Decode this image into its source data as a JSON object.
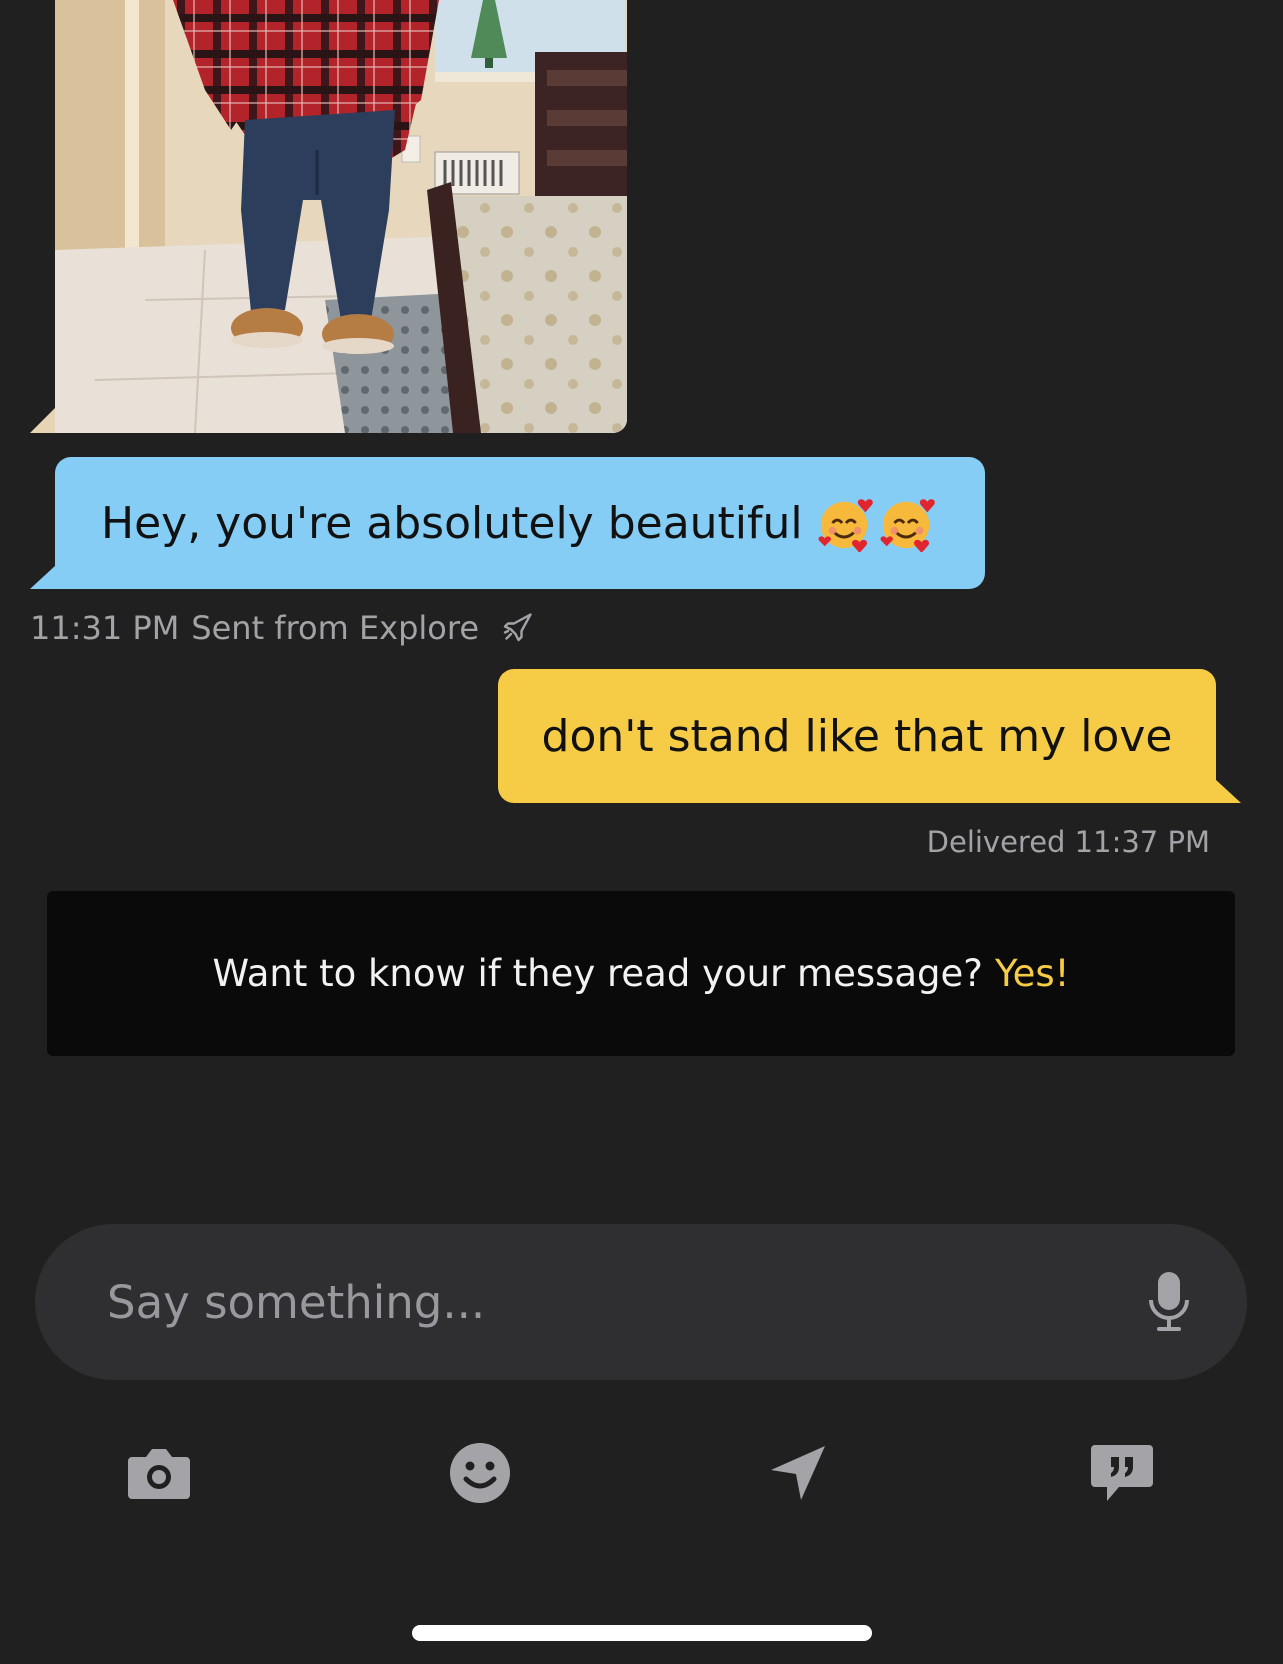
{
  "conversation": {
    "received_photo": {
      "icon": "photo-thumbnail"
    },
    "received_message": {
      "text": "Hey, you're absolutely beautiful",
      "emoji": "smiling-face-with-hearts",
      "emoji_count": 2,
      "bubble_color": "#86cdf5"
    },
    "received_meta": {
      "time": "11:31 PM",
      "source": "Sent from Explore",
      "icon": "rocket-icon"
    },
    "sent_message": {
      "text": "don't stand like that my love",
      "bubble_color": "#f6cb45"
    },
    "sent_meta": {
      "status": "Delivered 11:37 PM"
    }
  },
  "banner": {
    "text": "Want to know if they read your message?",
    "cta": "Yes!",
    "cta_color": "#f6cb45"
  },
  "composer": {
    "placeholder": "Say something...",
    "value": "",
    "mic_icon": "microphone-icon"
  },
  "toolbar": {
    "items": [
      {
        "icon": "camera-icon"
      },
      {
        "icon": "smiley-icon"
      },
      {
        "icon": "location-arrow-icon"
      },
      {
        "icon": "saved-phrases-icon"
      }
    ]
  },
  "colors": {
    "background": "#202021",
    "secondary_text": "#a3a3a7",
    "icon_gray": "#a4a4a8"
  }
}
